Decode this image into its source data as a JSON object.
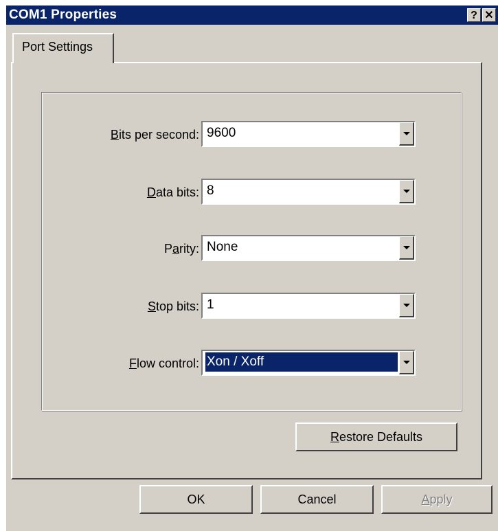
{
  "window": {
    "title": "COM1 Properties",
    "help_glyph": "?",
    "close_glyph": "✕"
  },
  "tabs": [
    {
      "label": "Port Settings",
      "active": true
    }
  ],
  "fields": {
    "bits_per_second": {
      "mnemonic": "B",
      "rest": "its per second:",
      "value": "9600"
    },
    "data_bits": {
      "mnemonic": "D",
      "rest": "ata bits:",
      "value": "8"
    },
    "parity": {
      "pre": "P",
      "mnemonic": "a",
      "rest": "rity:",
      "value": "None"
    },
    "stop_bits": {
      "mnemonic": "S",
      "rest": "top bits:",
      "value": "1"
    },
    "flow_control": {
      "mnemonic": "F",
      "rest": "low control:",
      "value": "Xon / Xoff",
      "selected": true
    }
  },
  "buttons": {
    "restore": {
      "mnemonic": "R",
      "rest": "estore Defaults"
    },
    "ok": "OK",
    "cancel": "Cancel",
    "apply": {
      "mnemonic": "A",
      "rest": "pply",
      "disabled": true
    }
  },
  "colors": {
    "titlebar": "#0a246a",
    "face": "#d4d0c8",
    "selection": "#0a246a"
  }
}
